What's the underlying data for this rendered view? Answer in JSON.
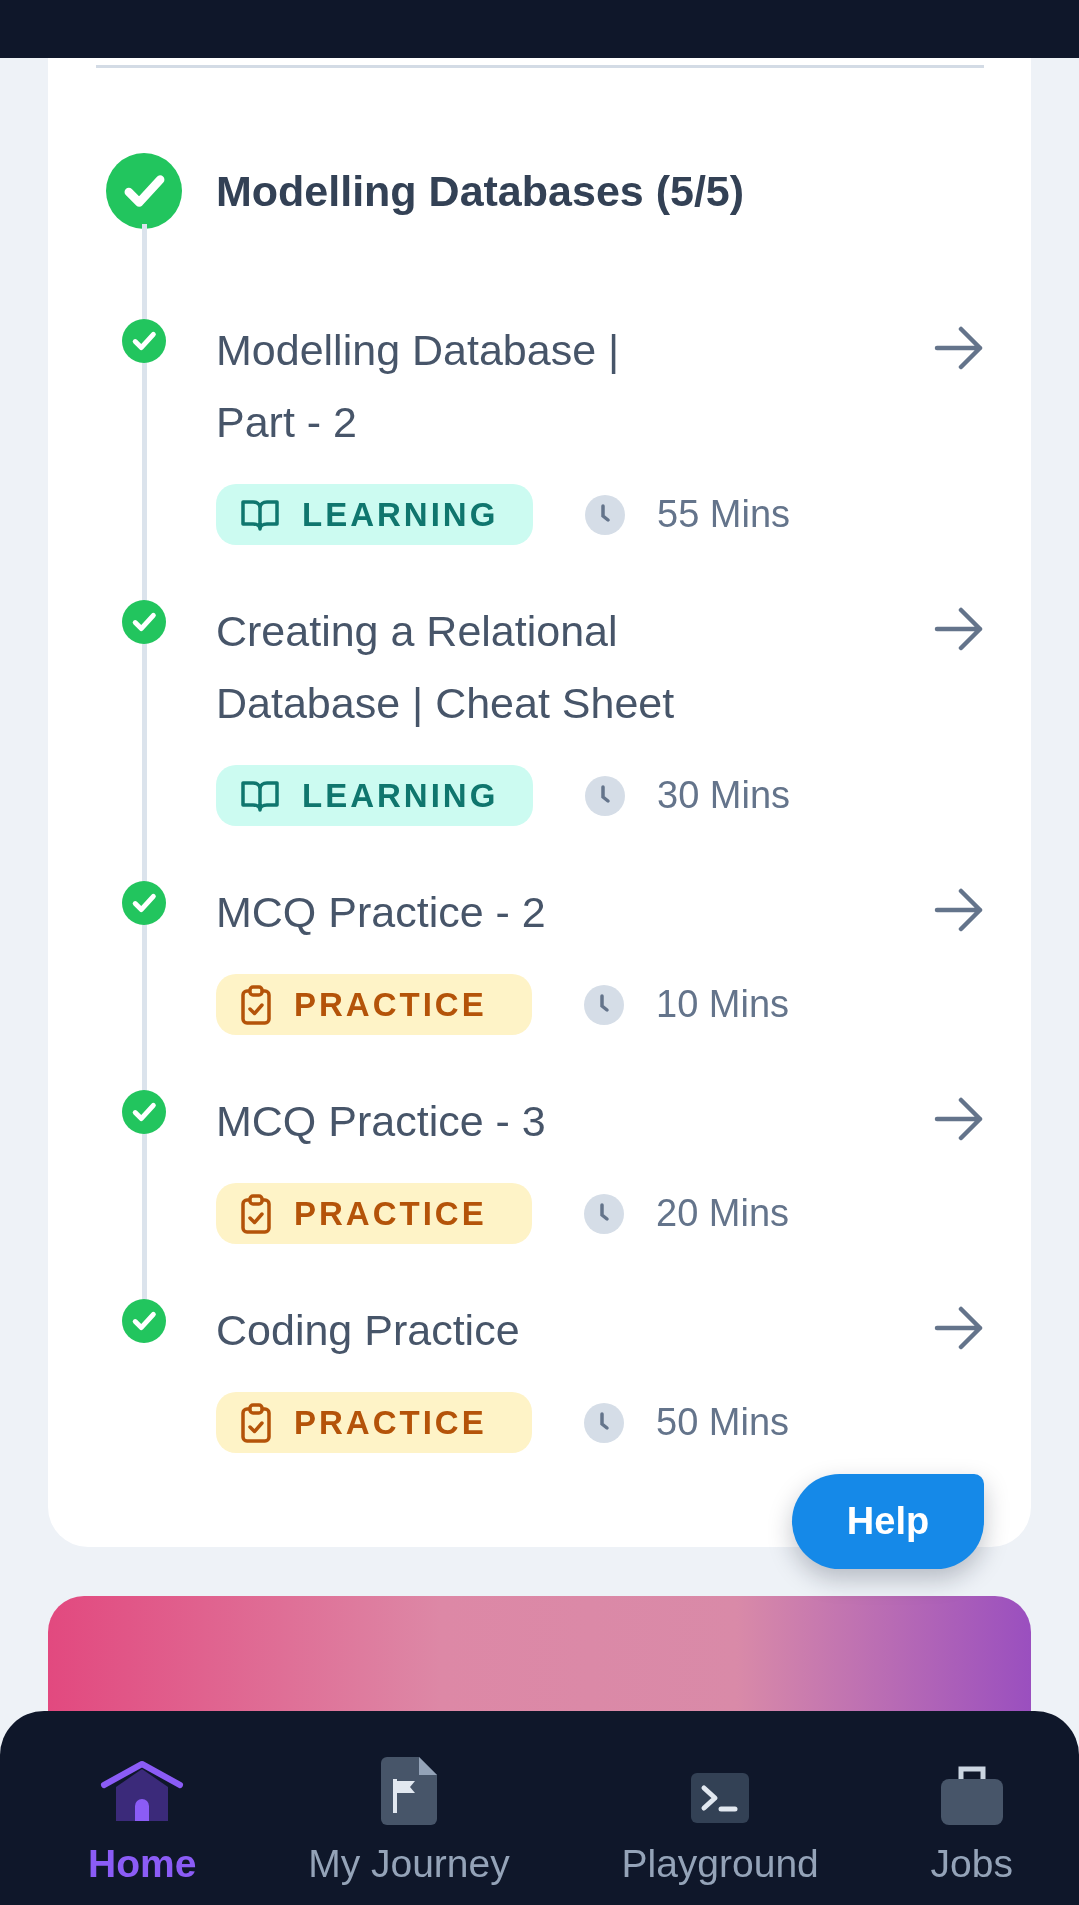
{
  "section": {
    "title": "Modelling Databases (5/5)",
    "completed": true
  },
  "items": [
    {
      "title": "Modelling Database | Part - 2",
      "completed": true,
      "tag": {
        "kind": "learning",
        "label": "LEARNING"
      },
      "duration": "55 Mins"
    },
    {
      "title": "Creating a Relational Database | Cheat Sheet",
      "completed": true,
      "tag": {
        "kind": "learning",
        "label": "LEARNING"
      },
      "duration": "30 Mins"
    },
    {
      "title": "MCQ Practice - 2",
      "completed": true,
      "tag": {
        "kind": "practice",
        "label": "PRACTICE"
      },
      "duration": "10 Mins"
    },
    {
      "title": "MCQ Practice - 3",
      "completed": true,
      "tag": {
        "kind": "practice",
        "label": "PRACTICE"
      },
      "duration": "20 Mins"
    },
    {
      "title": "Coding Practice",
      "completed": true,
      "tag": {
        "kind": "practice",
        "label": "PRACTICE"
      },
      "duration": "50 Mins"
    }
  ],
  "help_button": "Help",
  "bottom_nav": [
    {
      "label": "Home",
      "selected": true
    },
    {
      "label": "My Journey",
      "selected": false
    },
    {
      "label": "Playground",
      "selected": false
    },
    {
      "label": "Jobs",
      "selected": false
    }
  ]
}
